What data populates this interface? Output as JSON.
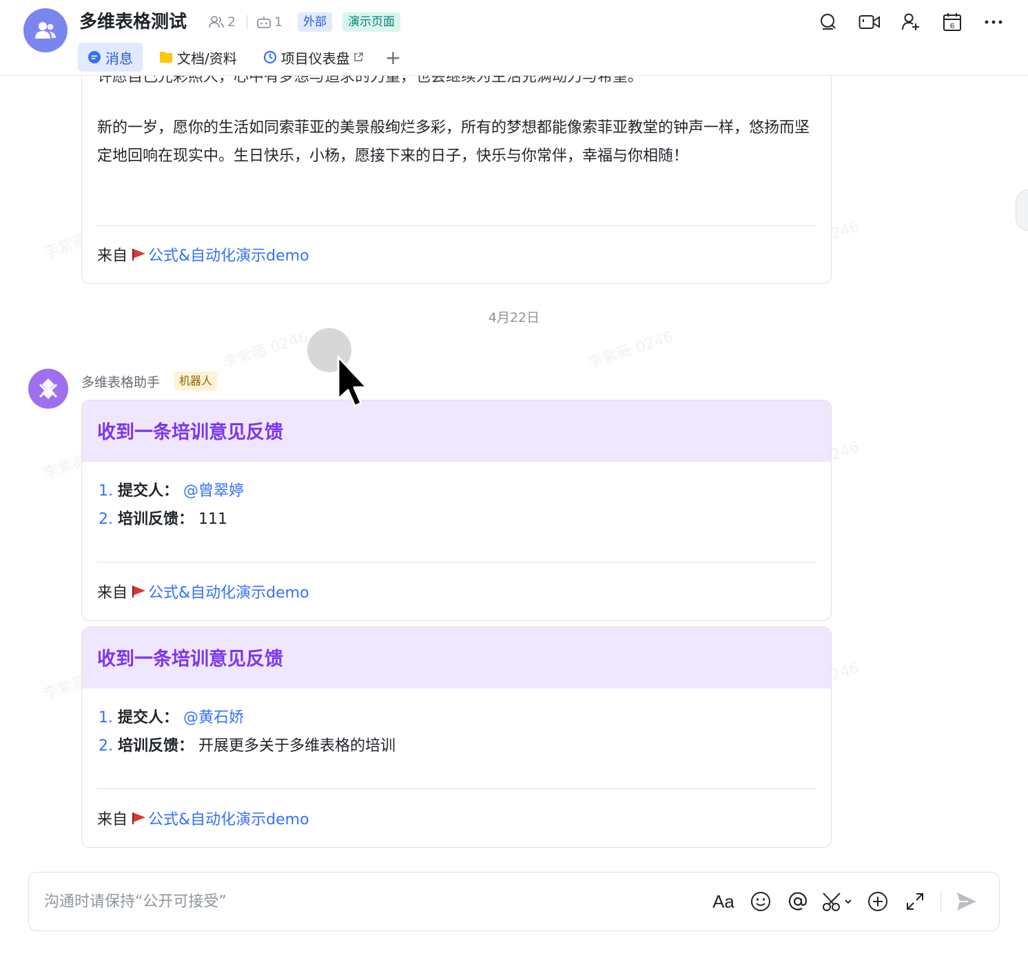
{
  "header": {
    "title": "多维表格测试",
    "member_count": "2",
    "bot_count": "1",
    "badge_external": "外部",
    "badge_demo": "演示页面",
    "tabs": [
      {
        "label": "消息",
        "icon": "chat-bubble-icon",
        "active": true
      },
      {
        "label": "文档/资料",
        "icon": "folder-icon",
        "active": false
      },
      {
        "label": "项目仪表盘",
        "icon": "dashboard-icon",
        "active": false
      }
    ],
    "add_tab": "+",
    "actions": [
      "search-icon",
      "video-call-icon",
      "add-member-icon",
      "calendar-icon",
      "more-icon"
    ],
    "calendar_day": "6"
  },
  "prev_message": {
    "truncated_line": "许愿自己光彩照人，心中有梦想与追求的力量，也会继续为生活充满动力与希望。",
    "body": "新的一岁，愿你的生活如同索菲亚的美景般绚烂多彩，所有的梦想都能像索菲亚教堂的钟声一样，悠扬而坚定地回响在现实中。生日快乐，小杨，愿接下来的日子，快乐与你常伴，幸福与你相随！",
    "footer_prefix": "来自",
    "footer_link": "公式&自动化演示demo"
  },
  "date_separator": "4月22日",
  "bot": {
    "name": "多维表格助手",
    "tag": "机器人"
  },
  "feedback_cards": [
    {
      "title": "收到一条培训意见反馈",
      "item1_num": "1.",
      "item1_key": "提交人",
      "item1_value": "@曾翠婷",
      "item2_num": "2.",
      "item2_key": "培训反馈",
      "item2_value": "111",
      "footer_prefix": "来自",
      "footer_link": "公式&自动化演示demo"
    },
    {
      "title": "收到一条培训意见反馈",
      "item1_num": "1.",
      "item1_key": "提交人",
      "item1_value": "@黄石娇",
      "item2_num": "2.",
      "item2_key": "培训反馈",
      "item2_value": "开展更多关于多维表格的培训",
      "footer_prefix": "来自",
      "footer_link": "公式&自动化演示demo"
    }
  ],
  "composer": {
    "placeholder": "沟通时请保持“公开可接受”",
    "font_label": "Aa",
    "tools": [
      "font-format-icon",
      "emoji-icon",
      "mention-icon",
      "scissors-icon",
      "plus-circle-icon",
      "expand-icon",
      "send-icon"
    ]
  },
  "watermark": "李紫薇 0246",
  "colors": {
    "accent": "#3370ff",
    "card_header": "#efe7fd",
    "card_title": "#7a35f0",
    "group_avatar": "#7b85ee",
    "bot_avatar": "#9f6ff1"
  }
}
